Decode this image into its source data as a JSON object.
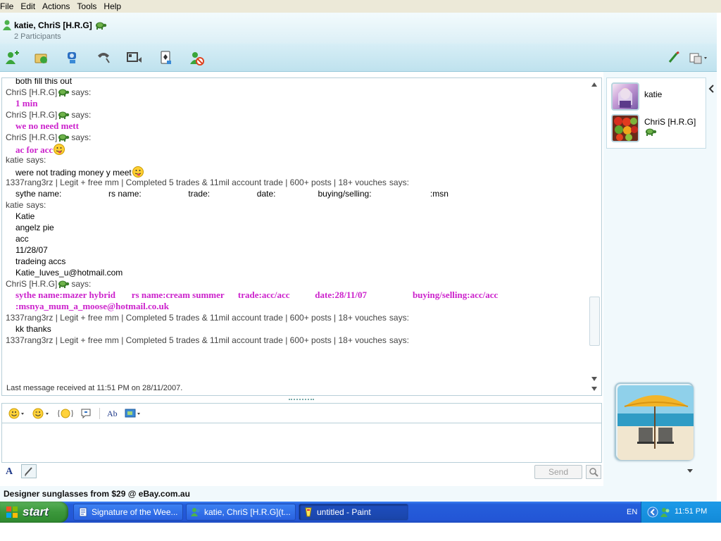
{
  "menu": [
    "File",
    "Edit",
    "Actions",
    "Tools",
    "Help"
  ],
  "header": {
    "title": "katie, ChriS [H.R.G]",
    "participants_count": "2 Participants"
  },
  "toolbar": {
    "icons": [
      "invite-contact-icon",
      "send-files-icon",
      "webcam-icon",
      "call-icon",
      "video-icon",
      "activities-icon",
      "block-icon"
    ],
    "right_icons": [
      "paint-brush-icon",
      "display-options-icon"
    ]
  },
  "conversation": {
    "lines": [
      {
        "type": "msg",
        "text": "both fill this out"
      },
      {
        "type": "header",
        "name": "ChriS [H.R.G]",
        "suffix": "says:",
        "turtle": true
      },
      {
        "type": "pink",
        "text": "1 min"
      },
      {
        "type": "header",
        "name": "ChriS [H.R.G]",
        "suffix": "says:",
        "turtle": true
      },
      {
        "type": "pink",
        "text": "we no need mett"
      },
      {
        "type": "header",
        "name": "ChriS [H.R.G]",
        "suffix": "says:",
        "turtle": true
      },
      {
        "type": "pink",
        "text": "ac for acc",
        "emoticon": true
      },
      {
        "type": "header",
        "name": "katie",
        "suffix": "says:"
      },
      {
        "type": "msg",
        "text": "were not trading money y meet",
        "emoticon": true
      },
      {
        "type": "header",
        "name": "1337rang3rz | Legit + free mm | Completed 5 trades & 11mil account trade | 600+ posts | 18+ vouches",
        "suffix": "says:"
      },
      {
        "type": "msg",
        "text": "sythe name:                    rs name:                    trade:                    date:                  buying/selling:                         :msn"
      },
      {
        "type": "header",
        "name": "katie",
        "suffix": "says:"
      },
      {
        "type": "msg",
        "text": "Katie"
      },
      {
        "type": "msg",
        "text": "angelz pie"
      },
      {
        "type": "msg",
        "text": "acc"
      },
      {
        "type": "msg",
        "text": "11/28/07"
      },
      {
        "type": "msg",
        "text": "tradeing accs"
      },
      {
        "type": "msg",
        "text": "Katie_luves_u@hotmail.com"
      },
      {
        "type": "header",
        "name": "ChriS [H.R.G]",
        "suffix": "says:",
        "turtle": true
      },
      {
        "type": "pink",
        "text": "sythe name:mazer hybrid       rs name:cream summer      trade:acc/acc           date:28/11/07                    buying/selling:acc/acc"
      },
      {
        "type": "pink",
        "text": ":msnya_mum_a_moose@hotmail.co.uk"
      },
      {
        "type": "header",
        "name": "1337rang3rz | Legit + free mm | Completed 5 trades & 11mil account trade | 600+ posts | 18+ vouches",
        "suffix": "says:"
      },
      {
        "type": "msg",
        "text": "kk thanks"
      },
      {
        "type": "header",
        "name": "1337rang3rz | Legit + free mm | Completed 5 trades & 11mil account trade | 600+ posts | 18+ vouches",
        "suffix": "says:"
      }
    ],
    "status": "Last message received at 11:51 PM on 28/11/2007."
  },
  "compose": {
    "tools": [
      "emoticon-icon",
      "wink-icon",
      "nudge-icon",
      "voice-clip-icon",
      "font-icon",
      "background-icon"
    ],
    "send_label": "Send"
  },
  "participants": [
    {
      "name": "katie"
    },
    {
      "name": "ChriS [H.R.G]"
    }
  ],
  "ad_text": "Designer sunglasses from $29 @ eBay.com.au",
  "taskbar": {
    "start_label": "start",
    "tasks": [
      {
        "label": "Signature of the Wee...",
        "active": false
      },
      {
        "label": "katie, ChriS [H.R.G](t...",
        "active": false
      },
      {
        "label": "untitled - Paint",
        "active": true
      }
    ],
    "lang": "EN",
    "clock": "11:51 PM"
  },
  "colors": {
    "pink_text": "#cc22cc",
    "taskbar_blue": "#245edb",
    "start_green": "#3b973b"
  }
}
